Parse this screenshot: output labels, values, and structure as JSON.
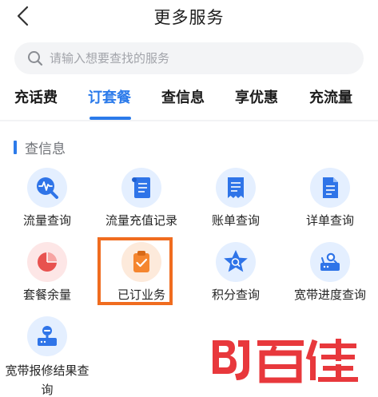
{
  "header": {
    "title": "更多服务"
  },
  "search": {
    "placeholder": "请输入想要查找的服务"
  },
  "tabs": [
    {
      "label": "充话费"
    },
    {
      "label": "订套餐",
      "active": true
    },
    {
      "label": "查信息"
    },
    {
      "label": "享优惠"
    },
    {
      "label": "充流量"
    }
  ],
  "section": {
    "title": "查信息"
  },
  "services": [
    {
      "label": "流量查询",
      "icon": "pulse-search-icon"
    },
    {
      "label": "流量充值记录",
      "icon": "scroll-icon"
    },
    {
      "label": "账单查询",
      "icon": "bill-icon"
    },
    {
      "label": "详单查询",
      "icon": "document-icon"
    },
    {
      "label": "套餐余量",
      "icon": "pie-chart-icon"
    },
    {
      "label": "已订业务",
      "icon": "clipboard-check-icon"
    },
    {
      "label": "积分查询",
      "icon": "star-badge-icon"
    },
    {
      "label": "宽带进度查询",
      "icon": "router-search-icon"
    },
    {
      "label": "宽带报修结果查询",
      "icon": "router-wrench-icon"
    }
  ],
  "watermark": {
    "text": "百佳",
    "logo_letters": "BJ"
  },
  "colors": {
    "accent": "#2c7bea",
    "icon_blue": "#2f74e8",
    "icon_red": "#e8524f",
    "icon_orange": "#f5862f",
    "highlight": "#f06c1f",
    "watermark_red": "#e8383c"
  }
}
